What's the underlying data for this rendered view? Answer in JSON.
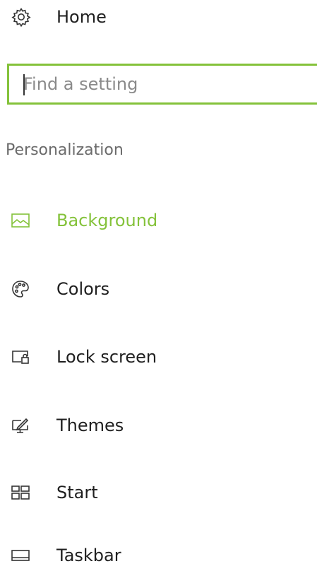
{
  "nav": {
    "home_label": "Home",
    "search_placeholder": "Find a setting",
    "section_title": "Personalization",
    "items": [
      {
        "label": "Background",
        "icon": "picture-icon",
        "active": true
      },
      {
        "label": "Colors",
        "icon": "palette-icon",
        "active": false
      },
      {
        "label": "Lock screen",
        "icon": "lock-screen-icon",
        "active": false
      },
      {
        "label": "Themes",
        "icon": "themes-icon",
        "active": false
      },
      {
        "label": "Start",
        "icon": "start-tiles-icon",
        "active": false
      },
      {
        "label": "Taskbar",
        "icon": "taskbar-icon",
        "active": false
      }
    ]
  },
  "colors": {
    "accent": "#84c23a",
    "text": "#1f1f1f",
    "section": "#6b6b6b"
  }
}
